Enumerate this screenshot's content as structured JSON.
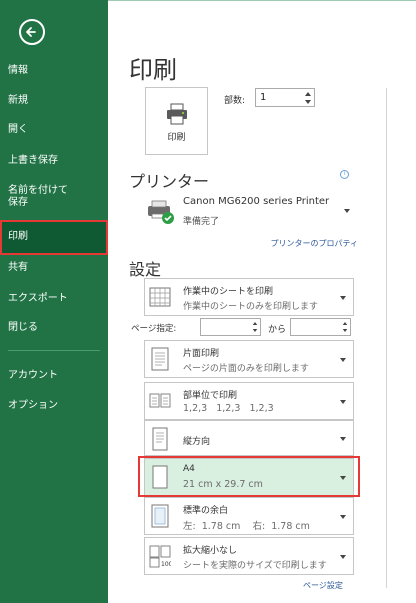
{
  "sidebar": {
    "items": [
      {
        "label": "情報"
      },
      {
        "label": "新規"
      },
      {
        "label": "開く"
      },
      {
        "label": "上書き保存"
      },
      {
        "label": "名前を付けて\n保存"
      },
      {
        "label": "印刷"
      },
      {
        "label": "共有"
      },
      {
        "label": "エクスポート"
      },
      {
        "label": "閉じる"
      },
      {
        "label": "アカウント"
      },
      {
        "label": "オプション"
      }
    ]
  },
  "page": {
    "title": "印刷"
  },
  "print_button": {
    "label": "印刷"
  },
  "copies": {
    "label": "部数:",
    "value": "1"
  },
  "printer": {
    "heading": "プリンター",
    "name": "Canon MG6200 series Printer",
    "status": "準備完了",
    "properties_link": "プリンターのプロパティ"
  },
  "settings": {
    "heading": "設定",
    "scope": {
      "title": "作業中のシートを印刷",
      "subtitle": "作業中のシートのみを印刷します"
    },
    "pages_label": "ページ指定:",
    "to_label": "から",
    "sides": {
      "title": "片面印刷",
      "subtitle": "ページの片面のみを印刷します"
    },
    "collate": {
      "title": "部単位で印刷",
      "subtitle": "1,2,3   1,2,3   1,2,3"
    },
    "orientation": {
      "title": "縦方向"
    },
    "paper": {
      "title": "A4",
      "subtitle": "21 cm x 29.7 cm"
    },
    "margins": {
      "title": "標準の余白",
      "subtitle": "左:  1.78 cm    右:  1.78 cm"
    },
    "scaling": {
      "title": "拡大縮小なし",
      "subtitle": "シートを実際のサイズで印刷します"
    },
    "page_setup_link": "ページ設定"
  },
  "colors": {
    "accent": "#217346",
    "selected": "#d9efe0",
    "highlight": "#e53935"
  }
}
